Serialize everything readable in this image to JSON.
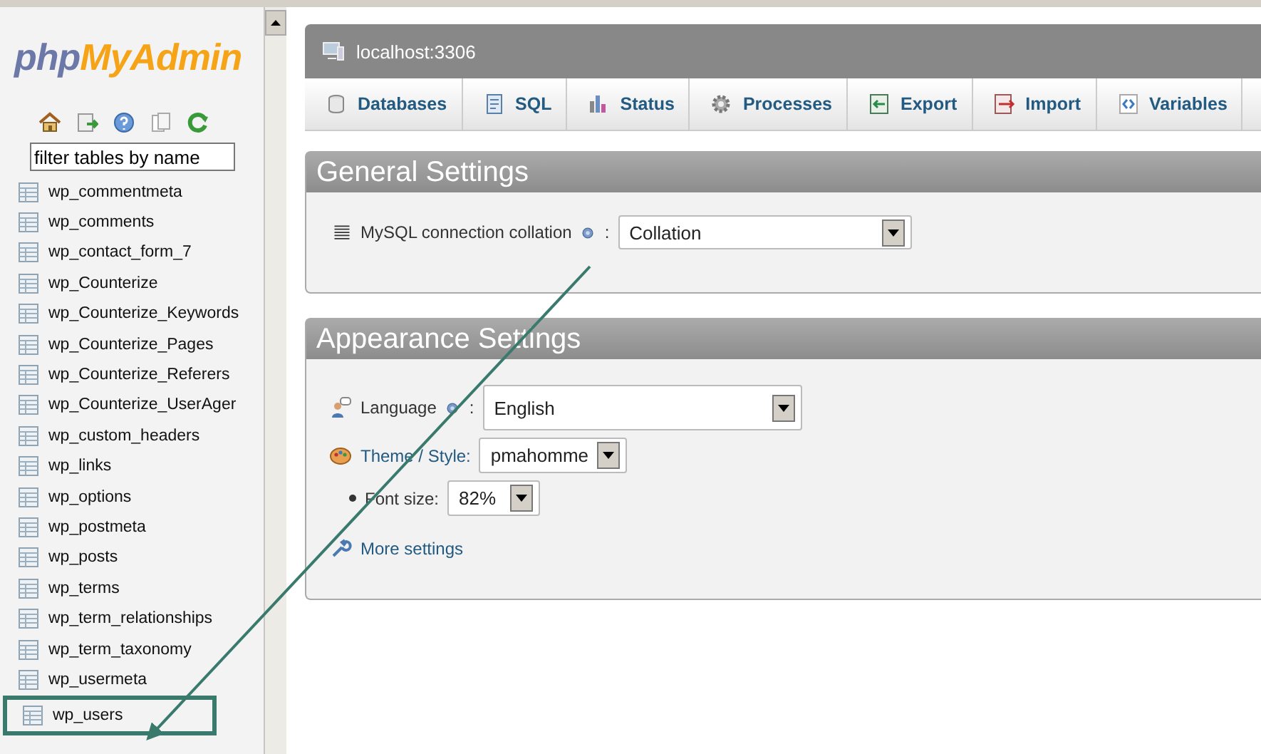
{
  "sidebar": {
    "logo": {
      "part1": "php",
      "part2": "MyAdmin"
    },
    "filter": {
      "value": "filter tables by name"
    },
    "tables": [
      {
        "name": "wp_commentmeta",
        "selected": false
      },
      {
        "name": "wp_comments",
        "selected": false
      },
      {
        "name": "wp_contact_form_7",
        "selected": false
      },
      {
        "name": "wp_Counterize",
        "selected": false
      },
      {
        "name": "wp_Counterize_Keywords",
        "selected": false
      },
      {
        "name": "wp_Counterize_Pages",
        "selected": false
      },
      {
        "name": "wp_Counterize_Referers",
        "selected": false
      },
      {
        "name": "wp_Counterize_UserAger",
        "selected": false
      },
      {
        "name": "wp_custom_headers",
        "selected": false
      },
      {
        "name": "wp_links",
        "selected": false
      },
      {
        "name": "wp_options",
        "selected": false
      },
      {
        "name": "wp_postmeta",
        "selected": false
      },
      {
        "name": "wp_posts",
        "selected": false
      },
      {
        "name": "wp_terms",
        "selected": false
      },
      {
        "name": "wp_term_relationships",
        "selected": false
      },
      {
        "name": "wp_term_taxonomy",
        "selected": false
      },
      {
        "name": "wp_usermeta",
        "selected": false
      },
      {
        "name": "wp_users",
        "selected": true
      }
    ]
  },
  "server": {
    "title": "localhost:3306"
  },
  "tabs": [
    {
      "label": "Databases",
      "kind": "databases"
    },
    {
      "label": "SQL",
      "kind": "sql"
    },
    {
      "label": "Status",
      "kind": "status"
    },
    {
      "label": "Processes",
      "kind": "processes"
    },
    {
      "label": "Export",
      "kind": "export"
    },
    {
      "label": "Import",
      "kind": "import"
    },
    {
      "label": "Variables",
      "kind": "variables"
    }
  ],
  "general_settings": {
    "title": "General Settings",
    "collation_label": "MySQL connection collation",
    "separator": ":",
    "collation_value": "Collation"
  },
  "appearance_settings": {
    "title": "Appearance Settings",
    "language": {
      "label": "Language",
      "separator": ":",
      "value": "English"
    },
    "theme": {
      "label": "Theme / Style:",
      "value": "pmahomme"
    },
    "font_size": {
      "label": "Font size:",
      "value": "82%"
    },
    "more_settings": "More settings"
  }
}
